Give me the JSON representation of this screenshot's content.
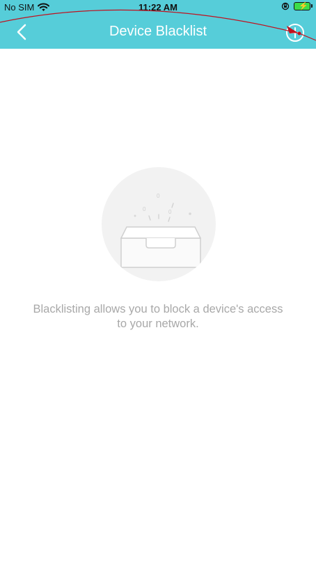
{
  "status_bar": {
    "carrier": "No SIM",
    "time": "11:22 AM",
    "wifi_icon": "wifi-icon",
    "orientation_lock_icon": "orientation-lock-icon",
    "battery_icon": "battery-charging-icon",
    "battery_color": "#3ddc4a"
  },
  "nav_bar": {
    "title": "Device Blacklist",
    "back_icon": "chevron-left-icon",
    "add_icon": "plus-circle-icon",
    "background": "#56cdd9"
  },
  "empty_state": {
    "illustration_icon": "empty-box-icon",
    "message": "Blacklisting allows you to block a device's access to your network."
  },
  "colors": {
    "accent": "#56cdd9",
    "annotation_arrow": "#c0111f",
    "empty_text": "#a8a8a8"
  }
}
